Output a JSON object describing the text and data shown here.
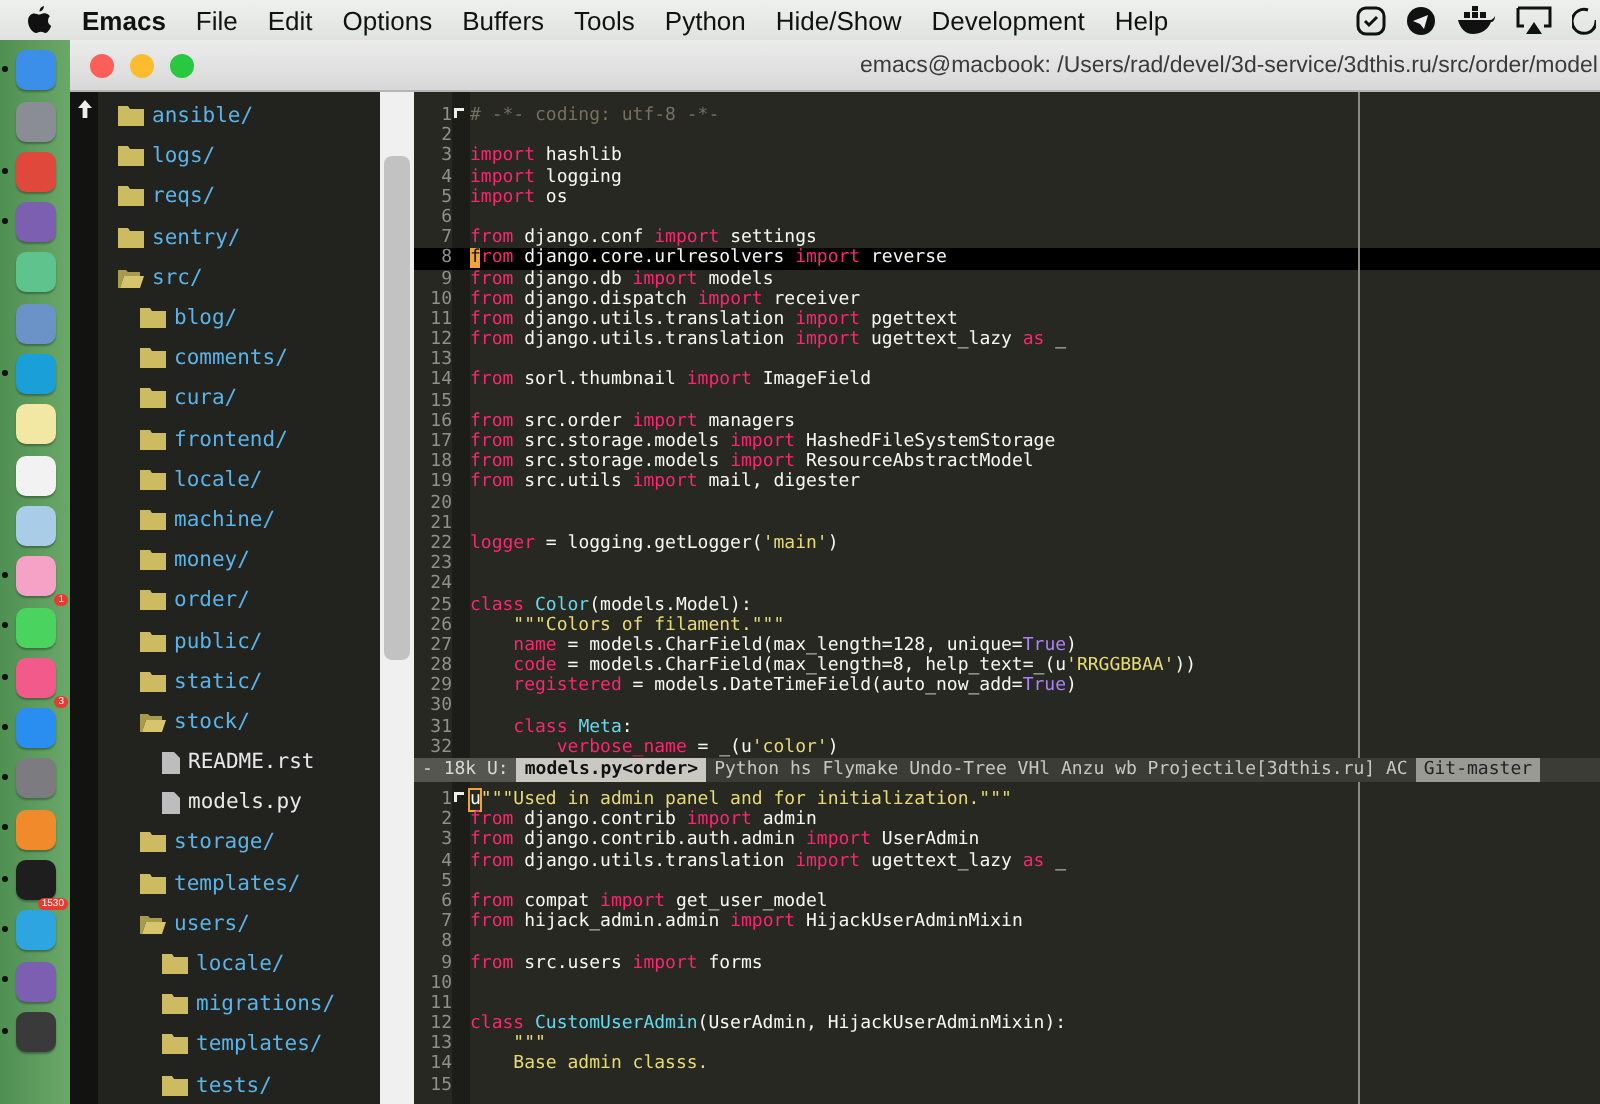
{
  "menu_bar": {
    "items": [
      {
        "label": "Emacs",
        "kind": "app"
      },
      {
        "label": "File",
        "kind": "menu"
      },
      {
        "label": "Edit",
        "kind": "menu"
      },
      {
        "label": "Options",
        "kind": "menu"
      },
      {
        "label": "Buffers",
        "kind": "menu"
      },
      {
        "label": "Tools",
        "kind": "menu"
      },
      {
        "label": "Python",
        "kind": "menu"
      },
      {
        "label": "Hide/Show",
        "kind": "menu"
      },
      {
        "label": "Development",
        "kind": "menu"
      },
      {
        "label": "Help",
        "kind": "menu"
      }
    ]
  },
  "dock": {
    "apps": [
      {
        "color": "#3b8fe8",
        "running": true
      },
      {
        "color": "#8a8d93",
        "running": false
      },
      {
        "color": "#e0483c",
        "running": true
      },
      {
        "color": "#7d5fb2",
        "running": true
      },
      {
        "color": "#5fc38e",
        "running": false
      },
      {
        "color": "#6c93c8",
        "running": false
      },
      {
        "color": "#1b9fd8",
        "running": true
      },
      {
        "color": "#f3e7a4",
        "running": false
      },
      {
        "color": "#f2f2f2",
        "running": false
      },
      {
        "color": "#a9cde6",
        "running": false
      },
      {
        "color": "#f4a2c6",
        "running": true
      },
      {
        "color": "#4bd35f",
        "running": true,
        "badge": "1"
      },
      {
        "color": "#f25a8c",
        "running": true
      },
      {
        "color": "#2a8ef0",
        "running": true,
        "badge": "3"
      },
      {
        "color": "#7c7c80",
        "running": true
      },
      {
        "color": "#f18a2a",
        "running": true
      },
      {
        "color": "#1e1e1e",
        "running": true
      },
      {
        "color": "#2ca5e0",
        "running": true,
        "badge": "1530"
      },
      {
        "color": "#7d5fb2",
        "running": true
      },
      {
        "color": "#3a3a3a",
        "running": true
      }
    ]
  },
  "window": {
    "title": "emacs@macbook: /Users/rad/devel/3d-service/3dthis.ru/src/order/model"
  },
  "tree": [
    {
      "name": "ansible/",
      "kind": "folder",
      "expanded": false
    },
    {
      "name": "logs/",
      "kind": "folder",
      "expanded": false
    },
    {
      "name": "reqs/",
      "kind": "folder",
      "expanded": false
    },
    {
      "name": "sentry/",
      "kind": "folder",
      "expanded": false
    },
    {
      "name": "src/",
      "kind": "folder",
      "expanded": true,
      "children": [
        {
          "name": "blog/",
          "kind": "folder",
          "expanded": false
        },
        {
          "name": "comments/",
          "kind": "folder",
          "expanded": false
        },
        {
          "name": "cura/",
          "kind": "folder",
          "expanded": false
        },
        {
          "name": "frontend/",
          "kind": "folder",
          "expanded": false
        },
        {
          "name": "locale/",
          "kind": "folder",
          "expanded": false
        },
        {
          "name": "machine/",
          "kind": "folder",
          "expanded": false
        },
        {
          "name": "money/",
          "kind": "folder",
          "expanded": false
        },
        {
          "name": "order/",
          "kind": "folder",
          "expanded": false
        },
        {
          "name": "public/",
          "kind": "folder",
          "expanded": false
        },
        {
          "name": "static/",
          "kind": "folder",
          "expanded": false
        },
        {
          "name": "stock/",
          "kind": "folder",
          "expanded": true,
          "children": [
            {
              "name": "README.rst",
              "kind": "file"
            },
            {
              "name": "models.py",
              "kind": "file"
            }
          ]
        },
        {
          "name": "storage/",
          "kind": "folder",
          "expanded": false
        },
        {
          "name": "templates/",
          "kind": "folder",
          "expanded": false
        },
        {
          "name": "users/",
          "kind": "folder",
          "expanded": true,
          "children": [
            {
              "name": "locale/",
              "kind": "folder",
              "expanded": false
            },
            {
              "name": "migrations/",
              "kind": "folder",
              "expanded": false
            },
            {
              "name": "templates/",
              "kind": "folder",
              "expanded": false
            },
            {
              "name": "tests/",
              "kind": "folder",
              "expanded": false
            }
          ]
        }
      ]
    }
  ],
  "panes": [
    {
      "active": true,
      "lines": [
        {
          "n": "1",
          "current": false,
          "tokens": [
            {
              "kind": "comment",
              "text": "# -*- coding: utf-8 -*-"
            }
          ]
        },
        {
          "n": "2",
          "current": false
        },
        {
          "n": "3",
          "current": false,
          "tokens": [
            {
              "kind": "kw",
              "text": "import"
            },
            {
              "kind": "plain",
              "text": " hashlib"
            }
          ]
        },
        {
          "n": "4",
          "current": false,
          "tokens": [
            {
              "kind": "kw",
              "text": "import"
            },
            {
              "kind": "plain",
              "text": " logging"
            }
          ]
        },
        {
          "n": "5",
          "current": false,
          "tokens": [
            {
              "kind": "kw",
              "text": "import"
            },
            {
              "kind": "plain",
              "text": " os"
            }
          ]
        },
        {
          "n": "6",
          "current": false
        },
        {
          "n": "7",
          "current": false,
          "tokens": [
            {
              "kind": "kw",
              "text": "from"
            },
            {
              "kind": "plain",
              "text": " django.conf "
            },
            {
              "kind": "kw",
              "text": "import"
            },
            {
              "kind": "plain",
              "text": " settings"
            }
          ]
        },
        {
          "n": "8",
          "current": true,
          "tokens": [
            {
              "kind": "cursor",
              "text": "f"
            },
            {
              "kind": "kw",
              "text": "rom"
            },
            {
              "kind": "plain",
              "text": " django.core.urlresolvers "
            },
            {
              "kind": "kw",
              "text": "import"
            },
            {
              "kind": "plain",
              "text": " reverse"
            }
          ]
        },
        {
          "n": "9",
          "current": false,
          "tokens": [
            {
              "kind": "kw",
              "text": "from"
            },
            {
              "kind": "plain",
              "text": " django.db "
            },
            {
              "kind": "kw",
              "text": "import"
            },
            {
              "kind": "plain",
              "text": " models"
            }
          ]
        },
        {
          "n": "10",
          "current": false,
          "tokens": [
            {
              "kind": "kw",
              "text": "from"
            },
            {
              "kind": "plain",
              "text": " django.dispatch "
            },
            {
              "kind": "kw",
              "text": "import"
            },
            {
              "kind": "plain",
              "text": " receiver"
            }
          ]
        },
        {
          "n": "11",
          "current": false,
          "tokens": [
            {
              "kind": "kw",
              "text": "from"
            },
            {
              "kind": "plain",
              "text": " django.utils.translation "
            },
            {
              "kind": "kw",
              "text": "import"
            },
            {
              "kind": "plain",
              "text": " pgettext"
            }
          ]
        },
        {
          "n": "12",
          "current": false,
          "tokens": [
            {
              "kind": "kw",
              "text": "from"
            },
            {
              "kind": "plain",
              "text": " django.utils.translation "
            },
            {
              "kind": "kw",
              "text": "import"
            },
            {
              "kind": "plain",
              "text": " ugettext_lazy "
            },
            {
              "kind": "kw",
              "text": "as"
            },
            {
              "kind": "plain",
              "text": " _"
            }
          ]
        },
        {
          "n": "13",
          "current": false
        },
        {
          "n": "14",
          "current": false,
          "tokens": [
            {
              "kind": "kw",
              "text": "from"
            },
            {
              "kind": "plain",
              "text": " sorl.thumbnail "
            },
            {
              "kind": "kw",
              "text": "import"
            },
            {
              "kind": "plain",
              "text": " ImageField"
            }
          ]
        },
        {
          "n": "15",
          "current": false
        },
        {
          "n": "16",
          "current": false,
          "tokens": [
            {
              "kind": "kw",
              "text": "from"
            },
            {
              "kind": "plain",
              "text": " src.order "
            },
            {
              "kind": "kw",
              "text": "import"
            },
            {
              "kind": "plain",
              "text": " managers"
            }
          ]
        },
        {
          "n": "17",
          "current": false,
          "tokens": [
            {
              "kind": "kw",
              "text": "from"
            },
            {
              "kind": "plain",
              "text": " src.storage.models "
            },
            {
              "kind": "kw",
              "text": "import"
            },
            {
              "kind": "plain",
              "text": " HashedFileSystemStorage"
            }
          ]
        },
        {
          "n": "18",
          "current": false,
          "tokens": [
            {
              "kind": "kw",
              "text": "from"
            },
            {
              "kind": "plain",
              "text": " src.storage.models "
            },
            {
              "kind": "kw",
              "text": "import"
            },
            {
              "kind": "plain",
              "text": " ResourceAbstractModel"
            }
          ]
        },
        {
          "n": "19",
          "current": false,
          "tokens": [
            {
              "kind": "kw",
              "text": "from"
            },
            {
              "kind": "plain",
              "text": " src.utils "
            },
            {
              "kind": "kw",
              "text": "import"
            },
            {
              "kind": "plain",
              "text": " mail, digester"
            }
          ]
        },
        {
          "n": "20",
          "current": false
        },
        {
          "n": "21",
          "current": false
        },
        {
          "n": "22",
          "current": false,
          "tokens": [
            {
              "kind": "var",
              "text": "logger"
            },
            {
              "kind": "plain",
              "text": " = logging.getLogger("
            },
            {
              "kind": "str",
              "text": "'main'"
            },
            {
              "kind": "plain",
              "text": ")"
            }
          ]
        },
        {
          "n": "23",
          "current": false
        },
        {
          "n": "24",
          "current": false
        },
        {
          "n": "25",
          "current": false,
          "tokens": [
            {
              "kind": "kw",
              "text": "class"
            },
            {
              "kind": "type",
              "text": " Color"
            },
            {
              "kind": "plain",
              "text": "(models.Model):"
            }
          ]
        },
        {
          "n": "26",
          "current": false,
          "tokens": [
            {
              "kind": "str",
              "text": "    \"\"\"Colors of filament.\"\"\""
            }
          ]
        },
        {
          "n": "27",
          "current": false,
          "tokens": [
            {
              "kind": "var",
              "text": "    name"
            },
            {
              "kind": "plain",
              "text": " = models.CharField(max_length=128, unique="
            },
            {
              "kind": "const",
              "text": "True"
            },
            {
              "kind": "plain",
              "text": ")"
            }
          ]
        },
        {
          "n": "28",
          "current": false,
          "tokens": [
            {
              "kind": "var",
              "text": "    code"
            },
            {
              "kind": "plain",
              "text": " = models.CharField(max_length=8, help_text=_(u"
            },
            {
              "kind": "str",
              "text": "'RRGGBBAA'"
            },
            {
              "kind": "plain",
              "text": "))"
            }
          ]
        },
        {
          "n": "29",
          "current": false,
          "tokens": [
            {
              "kind": "var",
              "text": "    registered"
            },
            {
              "kind": "plain",
              "text": " = models.DateTimeField(auto_now_add="
            },
            {
              "kind": "const",
              "text": "True"
            },
            {
              "kind": "plain",
              "text": ")"
            }
          ]
        },
        {
          "n": "30",
          "current": false
        },
        {
          "n": "31",
          "current": false,
          "tokens": [
            {
              "kind": "kw",
              "text": "    class"
            },
            {
              "kind": "type",
              "text": " Meta"
            },
            {
              "kind": "plain",
              "text": ":"
            }
          ]
        },
        {
          "n": "32",
          "current": false,
          "tokens": [
            {
              "kind": "var",
              "text": "        verbose_name"
            },
            {
              "kind": "plain",
              "text": " = _(u"
            },
            {
              "kind": "str",
              "text": "'color'"
            },
            {
              "kind": "plain",
              "text": ")"
            }
          ]
        }
      ]
    },
    {
      "active": false,
      "lines": [
        {
          "n": "1",
          "current": false,
          "tokens": [
            {
              "kind": "cursor",
              "text": "u"
            },
            {
              "kind": "str",
              "text": "\"\"\"Used in admin panel and for initialization.\"\"\""
            }
          ]
        },
        {
          "n": "2",
          "current": false,
          "tokens": [
            {
              "kind": "kw",
              "text": "from"
            },
            {
              "kind": "plain",
              "text": " django.contrib "
            },
            {
              "kind": "kw",
              "text": "import"
            },
            {
              "kind": "plain",
              "text": " admin"
            }
          ]
        },
        {
          "n": "3",
          "current": false,
          "tokens": [
            {
              "kind": "kw",
              "text": "from"
            },
            {
              "kind": "plain",
              "text": " django.contrib.auth.admin "
            },
            {
              "kind": "kw",
              "text": "import"
            },
            {
              "kind": "plain",
              "text": " UserAdmin"
            }
          ]
        },
        {
          "n": "4",
          "current": false,
          "tokens": [
            {
              "kind": "kw",
              "text": "from"
            },
            {
              "kind": "plain",
              "text": " django.utils.translation "
            },
            {
              "kind": "kw",
              "text": "import"
            },
            {
              "kind": "plain",
              "text": " ugettext_lazy "
            },
            {
              "kind": "kw",
              "text": "as"
            },
            {
              "kind": "plain",
              "text": " _"
            }
          ]
        },
        {
          "n": "5",
          "current": false
        },
        {
          "n": "6",
          "current": false,
          "tokens": [
            {
              "kind": "kw",
              "text": "from"
            },
            {
              "kind": "plain",
              "text": " compat "
            },
            {
              "kind": "kw",
              "text": "import"
            },
            {
              "kind": "plain",
              "text": " get_user_model"
            }
          ]
        },
        {
          "n": "7",
          "current": false,
          "tokens": [
            {
              "kind": "kw",
              "text": "from"
            },
            {
              "kind": "plain",
              "text": " hijack_admin.admin "
            },
            {
              "kind": "kw",
              "text": "import"
            },
            {
              "kind": "plain",
              "text": " HijackUserAdminMixin"
            }
          ]
        },
        {
          "n": "8",
          "current": false
        },
        {
          "n": "9",
          "current": false,
          "tokens": [
            {
              "kind": "kw",
              "text": "from"
            },
            {
              "kind": "plain",
              "text": " src.users "
            },
            {
              "kind": "kw",
              "text": "import"
            },
            {
              "kind": "plain",
              "text": " forms"
            }
          ]
        },
        {
          "n": "10",
          "current": false
        },
        {
          "n": "11",
          "current": false
        },
        {
          "n": "12",
          "current": false,
          "tokens": [
            {
              "kind": "kw",
              "text": "class"
            },
            {
              "kind": "type",
              "text": " CustomUserAdmin"
            },
            {
              "kind": "plain",
              "text": "(UserAdmin, HijackUserAdminMixin):"
            }
          ]
        },
        {
          "n": "13",
          "current": false,
          "tokens": [
            {
              "kind": "str",
              "text": "    \"\"\""
            }
          ]
        },
        {
          "n": "14",
          "current": false,
          "tokens": [
            {
              "kind": "str",
              "text": "    Base admin classs."
            }
          ]
        },
        {
          "n": "15",
          "current": false
        }
      ]
    }
  ],
  "mode_line": [
    {
      "kind": "status",
      "text": "- 18k U:"
    },
    {
      "kind": "buffer",
      "text": "models.py<order>"
    },
    {
      "kind": "modes",
      "text": "Python hs Flymake Undo-Tree VHl Anzu wb Projectile[3dthis.ru] AC"
    },
    {
      "kind": "vc",
      "text": "Git-master"
    }
  ]
}
